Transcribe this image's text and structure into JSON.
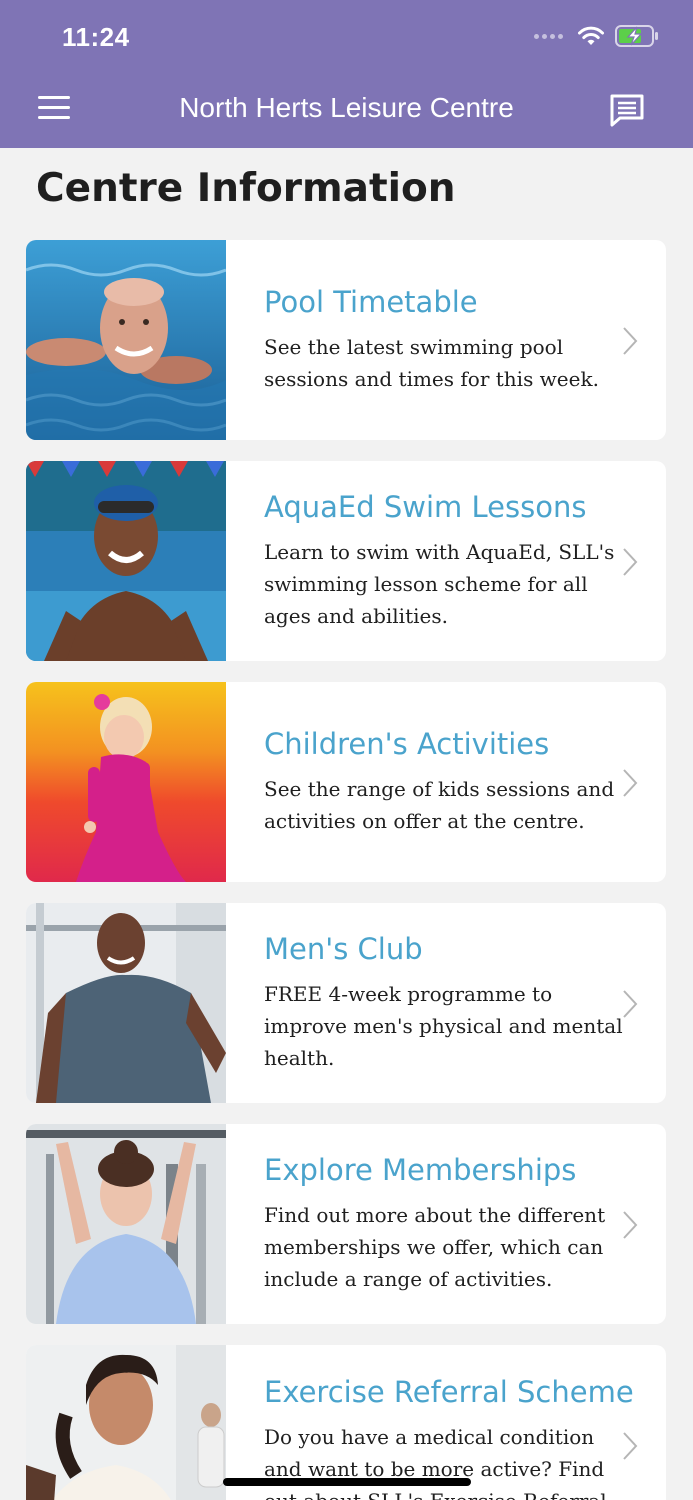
{
  "status_bar": {
    "time": "11:24"
  },
  "nav": {
    "title": "North Herts Leisure Centre",
    "menu_icon": "hamburger-menu-icon",
    "chat_icon": "message-icon"
  },
  "page": {
    "title": "Centre Information"
  },
  "cards": [
    {
      "title": "Pool Timetable",
      "description": "See the latest swimming pool sessions and times for this week.",
      "image": "swimmer-photo"
    },
    {
      "title": "AquaEd Swim Lessons",
      "description": "Learn to swim with AquaEd, SLL's swimming lesson scheme for all ages and abilities.",
      "image": "child-swimmer-photo"
    },
    {
      "title": "Children's Activities",
      "description": "See the range of kids sessions and activities on offer at the centre.",
      "image": "toddler-photo"
    },
    {
      "title": "Men's Club",
      "description": "FREE 4-week programme to improve men's physical and mental health.",
      "image": "man-gym-photo"
    },
    {
      "title": "Explore Memberships",
      "description": "Find out more about the different memberships we offer, which can include a range of activities.",
      "image": "woman-weights-photo"
    },
    {
      "title": "Exercise Referral Scheme",
      "description": "Do you have a medical condition and want to be more active? Find out about SLL's Exercise Referral Scheme",
      "image": "woman-class-photo"
    }
  ],
  "colors": {
    "header": "#7f74b5",
    "accent": "#4aa3cc",
    "background": "#f2f2f2",
    "battery": "#5ccf4a"
  }
}
